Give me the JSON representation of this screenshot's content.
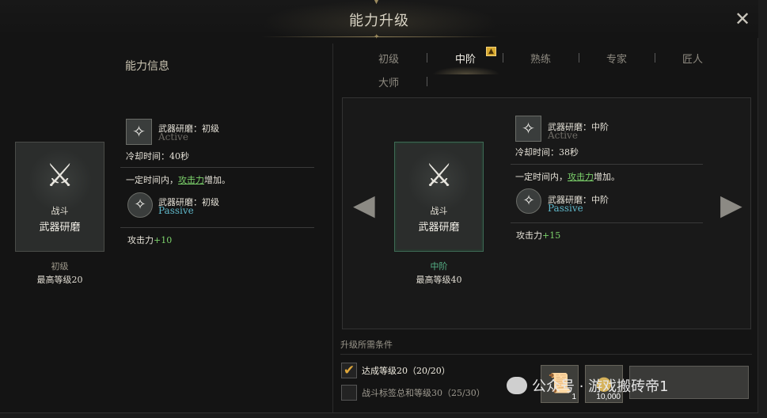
{
  "header": {
    "title": "能力升级",
    "close_icon": "close-icon"
  },
  "left": {
    "section_title": "能力信息",
    "card": {
      "category": "战斗",
      "name": "武器研磨"
    },
    "level": "初级",
    "max_level": "最高等级20",
    "active_skill": {
      "name": "武器研磨：初级",
      "type": "Active",
      "cooldown": "冷却时间：40秒"
    },
    "effect_prefix": "一定时间内，",
    "effect_link": "攻击力",
    "effect_suffix": "增加。",
    "passive_skill": {
      "name": "武器研磨：初级",
      "type": "Passive"
    },
    "stat_label": "攻击力",
    "stat_value": "+10"
  },
  "tabs": [
    {
      "label": "初级"
    },
    {
      "label": "中阶"
    },
    {
      "label": "熟练"
    },
    {
      "label": "专家"
    },
    {
      "label": "匠人"
    },
    {
      "label": "大师"
    }
  ],
  "preview": {
    "card": {
      "category": "战斗",
      "name": "武器研磨"
    },
    "level": "中阶",
    "max_level": "最高等级40",
    "active_skill": {
      "name": "武器研磨：中阶",
      "type": "Active",
      "cooldown": "冷却时间：38秒"
    },
    "effect_prefix": "一定时间内，",
    "effect_link": "攻击力",
    "effect_suffix": "增加。",
    "passive_skill": {
      "name": "武器研磨：中阶",
      "type": "Passive"
    },
    "stat_label": "攻击力",
    "stat_value": "+15"
  },
  "requirements": {
    "title": "升级所需条件",
    "items": [
      {
        "text": "达成等级20（20/20）",
        "met": true
      },
      {
        "text": "战斗标签总和等级30（25/30）",
        "met": false
      }
    ]
  },
  "materials": [
    {
      "icon": "scroll-icon",
      "count": "1"
    },
    {
      "icon": "coin-icon",
      "count": "10,000"
    }
  ],
  "watermark": "公众号 · 游戏搬砖帝1",
  "colors": {
    "accent_green": "#7cd26b",
    "passive_blue": "#5fb7c9",
    "check_gold": "#e0a83a"
  }
}
